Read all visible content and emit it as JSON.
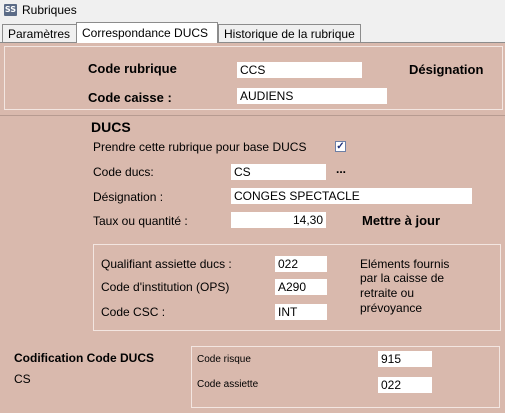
{
  "window": {
    "title": "Rubriques",
    "app_icon": "app-icon"
  },
  "tabs": [
    {
      "label": "Paramètres",
      "active": false
    },
    {
      "label": "Correspondance DUCS",
      "active": true
    },
    {
      "label": "Historique de la rubrique",
      "active": false
    }
  ],
  "header": {
    "code_rubrique_label": "Code rubrique",
    "code_rubrique_value": "CCS",
    "designation_heading": "Désignation",
    "code_caisse_label": "Code caisse :",
    "code_caisse_value": "AUDIENS"
  },
  "ducs": {
    "heading": "DUCS",
    "base_ducs_label": "Prendre cette rubrique pour base DUCS",
    "base_ducs_checked": true,
    "code_ducs_label": "Code ducs:",
    "code_ducs_value": "CS",
    "code_ducs_lookup": "...",
    "designation_label": "Désignation :",
    "designation_value": "CONGES SPECTACLE",
    "taux_label": "Taux ou quantité :",
    "taux_value": "14,30",
    "update_button": "Mettre à jour"
  },
  "caisse_info": {
    "qualifiant_label": "Qualifiant assiette  ducs :",
    "qualifiant_value": "022",
    "institution_label": "Code d'institution (OPS)",
    "institution_value": "A290",
    "csc_label": "Code CSC :",
    "csc_value": "INT",
    "note_line1": "Eléments fournis",
    "note_line2": "par la caisse de",
    "note_line3": "retraite ou",
    "note_line4": "prévoyance"
  },
  "codification": {
    "heading": "Codification Code DUCS",
    "value": "CS",
    "code_risque_label": "Code risque",
    "code_risque_value": "915",
    "code_assiette_label": "Code assiette",
    "code_assiette_value": "022"
  },
  "colors": {
    "background": "#d9b9ad",
    "field": "#ffffff",
    "chrome": "#f0f0f0"
  }
}
